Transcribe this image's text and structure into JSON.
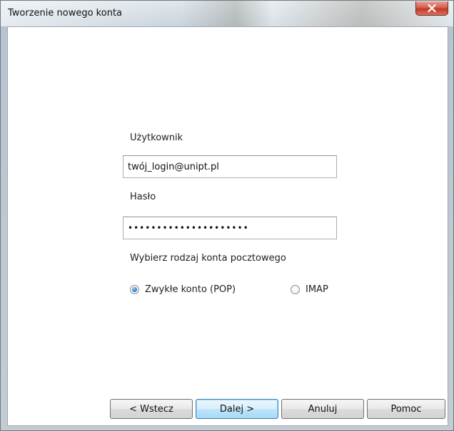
{
  "window": {
    "title": "Tworzenie nowego konta"
  },
  "form": {
    "user_label": "Użytkownik",
    "user_value": "twój_login@unipt.pl",
    "password_label": "Hasło",
    "password_value": "•••••••••••••••••••••",
    "account_type_label": "Wybierz rodzaj konta pocztowego",
    "account_types": [
      {
        "label": "Zwykłe konto (POP)",
        "selected": true
      },
      {
        "label": "IMAP",
        "selected": false
      }
    ]
  },
  "buttons": {
    "back": "< Wstecz",
    "next": "Dalej >",
    "cancel": "Anuluj",
    "help": "Pomoc"
  },
  "colors": {
    "accent": "#3c7fb1",
    "close_red": "#c0392b"
  }
}
